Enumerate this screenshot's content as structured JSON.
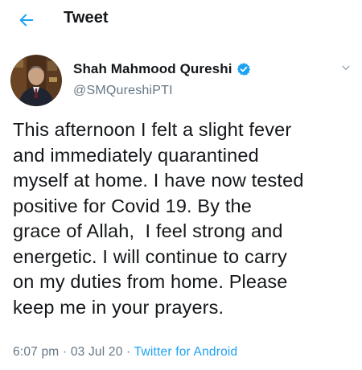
{
  "header": {
    "title": "Tweet",
    "back_icon": "arrow-left-icon",
    "accent": "#1da1f2"
  },
  "tweet": {
    "author_name": "Shah Mahmood Qureshi",
    "handle": "@SMQureshiPTI",
    "verified_icon": "verified-badge-icon",
    "menu_icon": "chevron-down-icon",
    "text_lines": [
      "This afternoon I felt a slight fever",
      "and immediately quarantined",
      "myself at home. I have now tested",
      "positive for Covid 19. By the",
      "grace of Allah,  I feel strong and",
      "energetic. I will continue to carry",
      "on my duties from home. Please",
      "keep me in your prayers."
    ],
    "time": "6:07 pm",
    "date": "03 Jul 20",
    "separator": "·",
    "source": "Twitter for Android"
  },
  "colors": {
    "text": "#14171a",
    "secondary": "#657786",
    "link": "#1da1f2"
  }
}
